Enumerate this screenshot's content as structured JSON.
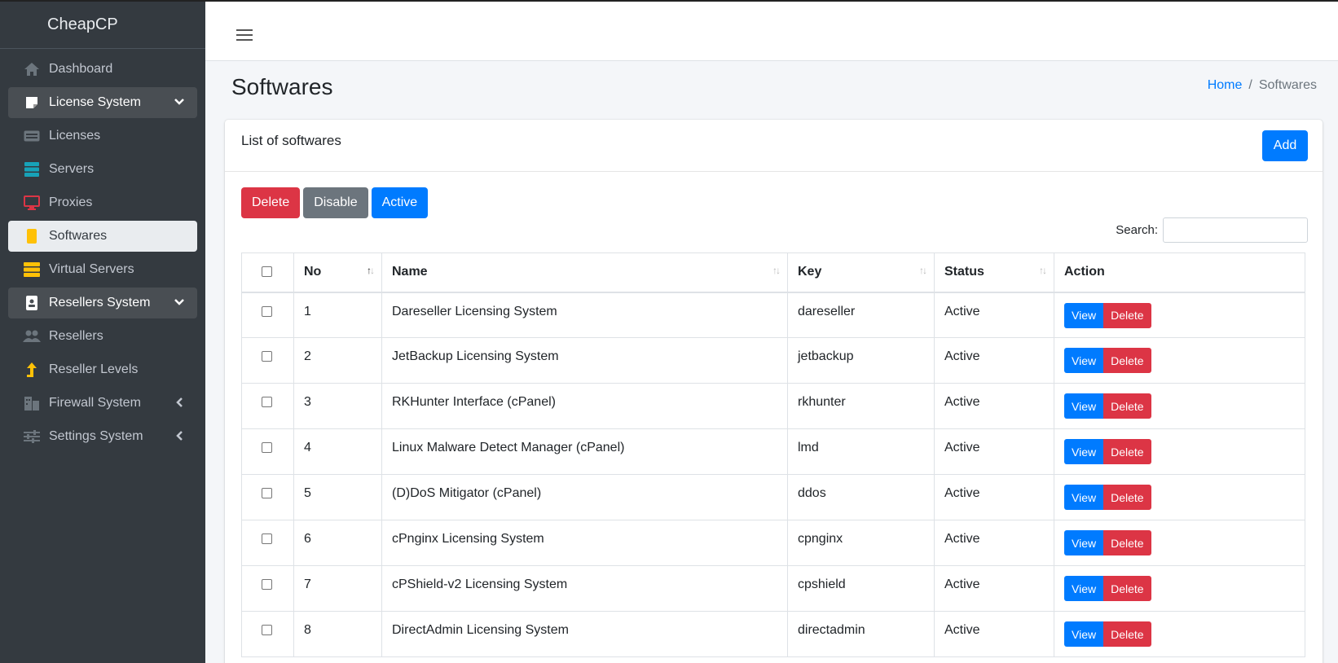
{
  "brand": "CheapCP",
  "sidebar": {
    "items": [
      {
        "label": "Dashboard",
        "icon": "home-icon",
        "color": "#6c757d",
        "state": "normal",
        "caret": ""
      },
      {
        "label": "License System",
        "icon": "sticky-note-icon",
        "color": "#ffffff",
        "state": "open",
        "caret": "down"
      },
      {
        "label": "Licenses",
        "icon": "keyboard-icon",
        "color": "#6c757d",
        "state": "normal",
        "caret": ""
      },
      {
        "label": "Servers",
        "icon": "server-icon",
        "color": "#17a2b8",
        "state": "normal",
        "caret": ""
      },
      {
        "label": "Proxies",
        "icon": "monitor-icon",
        "color": "#dc3545",
        "state": "normal",
        "caret": ""
      },
      {
        "label": "Softwares",
        "icon": "mobile-icon",
        "color": "#ffc107",
        "state": "active",
        "caret": ""
      },
      {
        "label": "Virtual Servers",
        "icon": "server-stack-icon",
        "color": "#ffc107",
        "state": "normal",
        "caret": ""
      },
      {
        "label": "Resellers System",
        "icon": "id-badge-icon",
        "color": "#ffffff",
        "state": "open",
        "caret": "down"
      },
      {
        "label": "Resellers",
        "icon": "users-icon",
        "color": "#6c757d",
        "state": "normal",
        "caret": ""
      },
      {
        "label": "Reseller Levels",
        "icon": "level-up-icon",
        "color": "#ffc107",
        "state": "normal",
        "caret": ""
      },
      {
        "label": "Firewall System",
        "icon": "building-icon",
        "color": "#6c757d",
        "state": "normal",
        "caret": "left"
      },
      {
        "label": "Settings System",
        "icon": "sliders-icon",
        "color": "#6c757d",
        "state": "normal",
        "caret": "left"
      }
    ]
  },
  "page": {
    "title": "Softwares",
    "breadcrumb_home": "Home",
    "breadcrumb_sep": "/",
    "breadcrumb_current": "Softwares"
  },
  "card": {
    "title": "List of softwares",
    "add_label": "Add",
    "bulk_delete": "Delete",
    "bulk_disable": "Disable",
    "bulk_active": "Active",
    "search_label": "Search:",
    "search_value": ""
  },
  "table": {
    "headers": {
      "no": "No",
      "name": "Name",
      "key": "Key",
      "status": "Status",
      "action": "Action"
    },
    "view_label": "View",
    "delete_label": "Delete",
    "rows": [
      {
        "no": "1",
        "name": "Dareseller Licensing System",
        "key": "dareseller",
        "status": "Active"
      },
      {
        "no": "2",
        "name": "JetBackup Licensing System",
        "key": "jetbackup",
        "status": "Active"
      },
      {
        "no": "3",
        "name": "RKHunter Interface (cPanel)",
        "key": "rkhunter",
        "status": "Active"
      },
      {
        "no": "4",
        "name": "Linux Malware Detect Manager (cPanel)",
        "key": "lmd",
        "status": "Active"
      },
      {
        "no": "5",
        "name": "(D)DoS Mitigator (cPanel)",
        "key": "ddos",
        "status": "Active"
      },
      {
        "no": "6",
        "name": "cPnginx Licensing System",
        "key": "cpnginx",
        "status": "Active"
      },
      {
        "no": "7",
        "name": "cPShield-v2 Licensing System",
        "key": "cpshield",
        "status": "Active"
      },
      {
        "no": "8",
        "name": "DirectAdmin Licensing System",
        "key": "directadmin",
        "status": "Active"
      }
    ]
  }
}
